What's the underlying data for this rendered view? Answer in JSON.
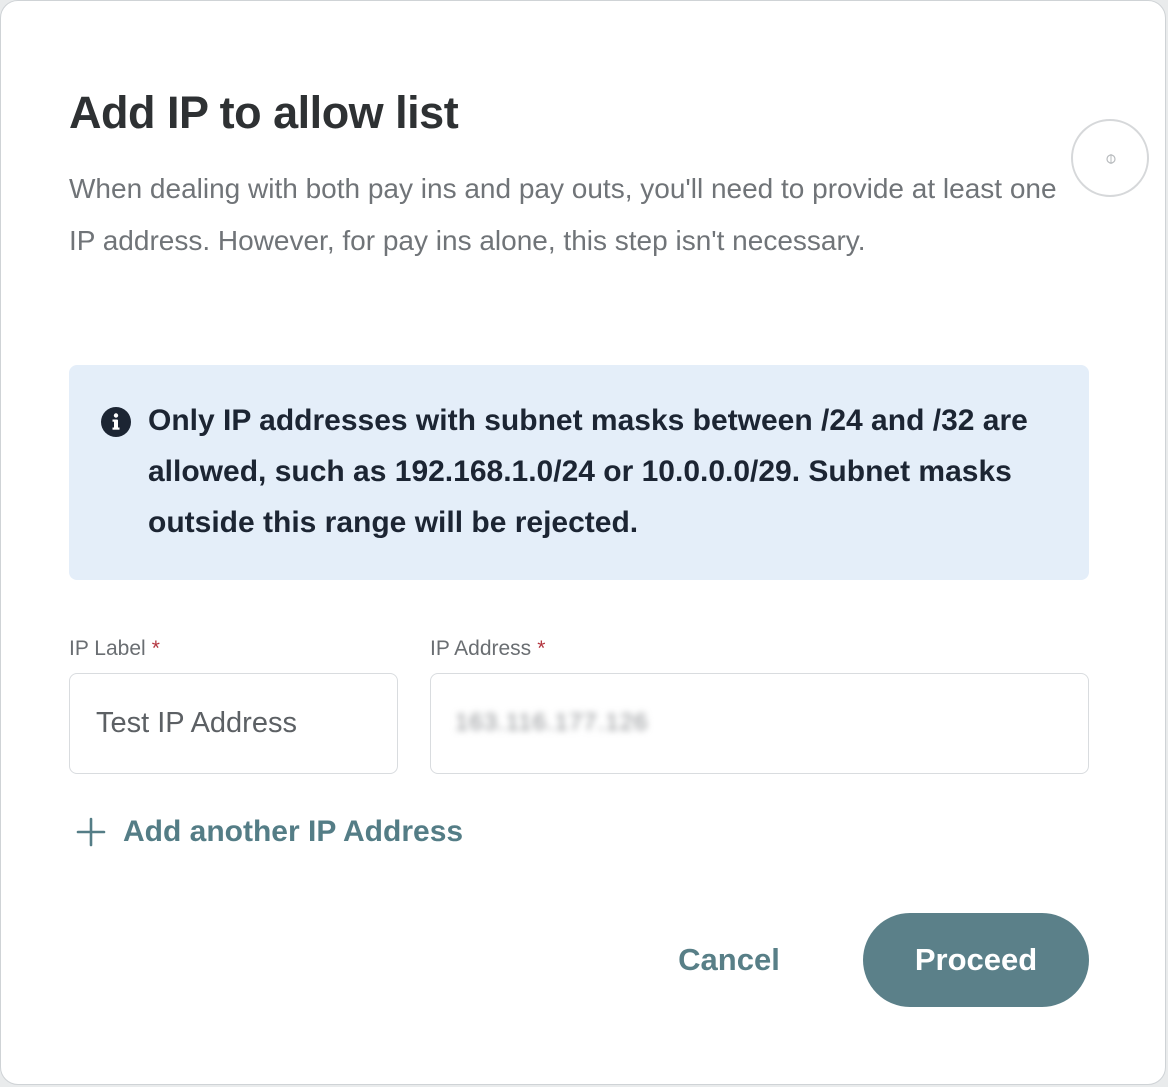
{
  "dialog": {
    "title": "Add IP to allow list",
    "description": "When dealing with both pay ins and pay outs, you'll need to provide at least one IP address. However, for pay ins alone, this step isn't necessary."
  },
  "info_box": {
    "icon": "info-icon",
    "text": "Only IP addresses with subnet masks between /24 and /32 are allowed, such as 192.168.1.0/24 or 10.0.0.0/29. Subnet masks outside this range will be rejected."
  },
  "form": {
    "ip_label": {
      "label": "IP Label",
      "required_marker": "*",
      "value": "Test IP Address"
    },
    "ip_address": {
      "label": "IP Address",
      "required_marker": "*",
      "value_obscured": "163.116.177.126"
    },
    "add_another_label": "Add another IP Address"
  },
  "actions": {
    "cancel_label": "Cancel",
    "proceed_label": "Proceed"
  },
  "colors": {
    "accent": "#5b8089",
    "info_background": "#e4eef9",
    "required": "#b3353f"
  }
}
